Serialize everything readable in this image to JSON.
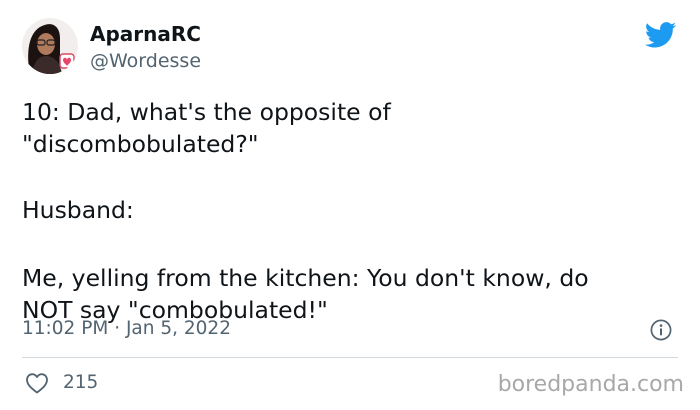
{
  "author": {
    "display_name": "AparnaRC",
    "handle": "@Wordesse",
    "avatar": "avatar-icon"
  },
  "brand_icon": "twitter-bird-icon",
  "tweet": {
    "lines": [
      "10: Dad, what's the opposite of\n\"discombobulated?\"",
      "Husband:",
      "Me, yelling from the kitchen: You don't know, do\nNOT say \"combobulated!\""
    ],
    "timestamp": "11:02 PM · Jan 5, 2022"
  },
  "engagement": {
    "likes": "215",
    "like_icon": "heart-icon"
  },
  "info_icon": "info-icon",
  "watermark": "boredpanda.com",
  "colors": {
    "text": "#0f1419",
    "muted": "#536471",
    "twitter_blue": "#1d9bf0",
    "divider": "#cfd9de",
    "watermark": "#a8a8a8"
  }
}
